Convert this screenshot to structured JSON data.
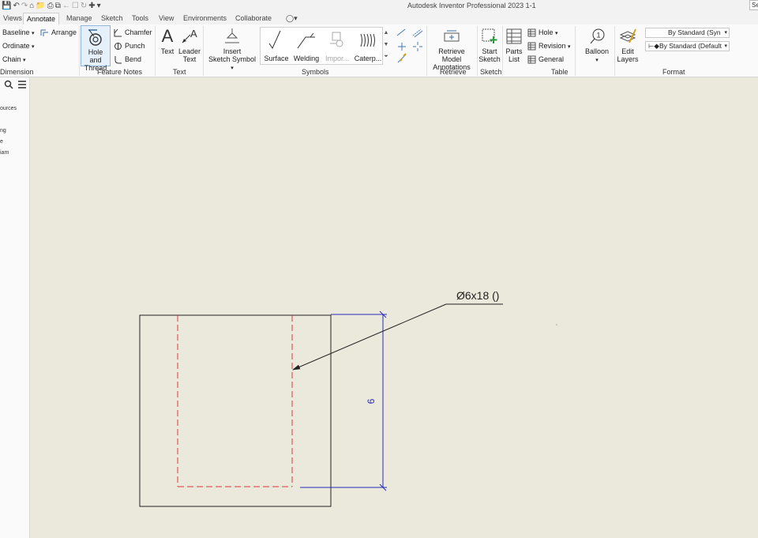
{
  "window": {
    "title": "Autodesk Inventor Professional 2023   1-1",
    "search_placeholder": "Se"
  },
  "tabs": [
    "Views",
    "Annotate",
    "Manage",
    "Sketch",
    "Tools",
    "View",
    "Environments",
    "Collaborate"
  ],
  "active_tab": "Annotate",
  "ribbon": {
    "dimension": {
      "items": [
        "Baseline",
        "Ordinate",
        "Chain"
      ],
      "arrange": "Arrange",
      "group_label": "Dimension"
    },
    "feature_notes": {
      "hole_thread": "Hole and Thread",
      "hole_thread_line1": "Hole and",
      "hole_thread_line2": "Thread",
      "chamfer": "Chamfer",
      "punch": "Punch",
      "bend": "Bend",
      "group_label": "Feature Notes"
    },
    "text": {
      "text": "Text",
      "leader_text_line1": "Leader",
      "leader_text_line2": "Text",
      "group_label": "Text"
    },
    "symbols": {
      "insert_line1": "Insert",
      "insert_line2": "Sketch Symbol",
      "gallery": [
        "Surface",
        "Welding",
        "Impor...",
        "Caterp..."
      ],
      "group_label": "Symbols"
    },
    "retrieve": {
      "line1": "Retrieve Model",
      "line2": "Annotations",
      "group_label": "Retrieve"
    },
    "sketch": {
      "line1": "Start",
      "line2": "Sketch",
      "group_label": "Sketch"
    },
    "table": {
      "parts_line1": "Parts",
      "parts_line2": "List",
      "hole": "Hole",
      "revision": "Revision",
      "general": "General",
      "group_label": "Table"
    },
    "balloon": "Balloon",
    "edit_layers_line1": "Edit",
    "edit_layers_line2": "Layers",
    "format": {
      "style1": "By Standard (Syn",
      "style2": "By Standard (Default",
      "group_label": "Format"
    }
  },
  "browser": {
    "items": [
      "ources",
      "ng",
      "e",
      "iam"
    ]
  },
  "drawing": {
    "hole_note": "Ø6x18 ()",
    "dimension_value": "9",
    "colors": {
      "part_outline": "#222222",
      "hidden_line": "#d83a3a",
      "dimension": "#2a2ab8",
      "sheet": "#ebe8dc"
    }
  }
}
